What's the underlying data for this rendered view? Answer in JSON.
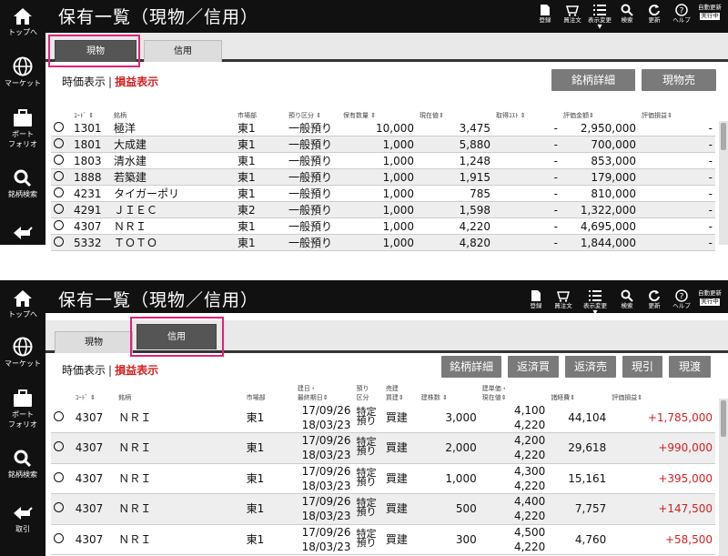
{
  "sidebar": {
    "top": "トップへ",
    "market": "マーケット",
    "portfolio": [
      "ポート",
      "フォリオ"
    ],
    "search": "銘柄検索",
    "trade": "取引"
  },
  "header": {
    "title": "保有一覧（現物／信用）",
    "buttons": [
      "登録",
      "買注文",
      "表示変更",
      "検索",
      "更新",
      "ヘルプ"
    ],
    "live_label": "自動更新",
    "live_state": "実行中"
  },
  "tabs": {
    "cash": "現物",
    "margin": "信用"
  },
  "toolbar": {
    "time": "時価表示",
    "pl": "損益表示"
  },
  "panel1": {
    "buttons": [
      "銘柄詳細",
      "現物売"
    ],
    "headers": [
      "ｺｰﾄﾞ ⇕",
      "銘柄",
      "市場部",
      "預り区分 ⇕",
      "保有数量 ⇕",
      "現在値⇕",
      "取得ｺｽﾄ ⇕",
      "評価金額⇕",
      "評価損益⇕"
    ],
    "rows": [
      [
        "1301",
        "極洋",
        "東1",
        "一般預り",
        "10,000",
        "3,475",
        "-",
        "2,950,000",
        "-"
      ],
      [
        "1801",
        "大成建",
        "東1",
        "一般預り",
        "1,000",
        "5,880",
        "-",
        "700,000",
        "-"
      ],
      [
        "1803",
        "清水建",
        "東1",
        "一般預り",
        "1,000",
        "1,248",
        "-",
        "853,000",
        "-"
      ],
      [
        "1888",
        "若築建",
        "東1",
        "一般預り",
        "1,000",
        "1,915",
        "-",
        "179,000",
        "-"
      ],
      [
        "4231",
        "タイガーポリ",
        "東1",
        "一般預り",
        "1,000",
        "785",
        "-",
        "810,000",
        "-"
      ],
      [
        "4291",
        "ＪＩＥＣ",
        "東2",
        "一般預り",
        "1,000",
        "1,598",
        "-",
        "1,322,000",
        "-"
      ],
      [
        "4307",
        "ＮＲＩ",
        "東1",
        "一般預り",
        "1,000",
        "4,220",
        "-",
        "4,695,000",
        "-"
      ],
      [
        "5332",
        "ＴＯＴＯ",
        "東1",
        "一般預り",
        "1,000",
        "4,820",
        "-",
        "1,844,000",
        "-"
      ]
    ]
  },
  "panel2": {
    "buttons": [
      "銘柄詳細",
      "返済買",
      "返済売",
      "現引",
      "現渡"
    ],
    "headers": [
      "ｺｰﾄﾞ ⇕",
      "銘柄",
      "市場部",
      "建日・\n最終期日⇕",
      "預り\n区分",
      "売建\n買建⇕",
      "建株数 ⇕",
      "建単価・\n現在値⇕",
      "諸経費⇕",
      "評価損益⇕"
    ],
    "rows": [
      [
        "4307",
        "ＮＲＩ",
        "東1",
        "17/09/26",
        "18/03/23",
        "特定預り",
        "買建",
        "3,000",
        "4,100",
        "4,220",
        "44,104",
        "+1,785,000"
      ],
      [
        "4307",
        "ＮＲＩ",
        "東1",
        "17/09/26",
        "18/03/23",
        "特定預り",
        "買建",
        "2,000",
        "4,200",
        "4,220",
        "29,618",
        "+990,000"
      ],
      [
        "4307",
        "ＮＲＩ",
        "東1",
        "17/09/26",
        "18/03/23",
        "特定預り",
        "買建",
        "1,000",
        "4,300",
        "4,220",
        "15,161",
        "+395,000"
      ],
      [
        "4307",
        "ＮＲＩ",
        "東1",
        "17/09/26",
        "18/03/23",
        "特定預り",
        "買建",
        "500",
        "4,400",
        "4,220",
        "7,757",
        "+147,500"
      ],
      [
        "4307",
        "ＮＲＩ",
        "東1",
        "17/09/26",
        "18/03/23",
        "特定預り",
        "買建",
        "300",
        "4,500",
        "4,220",
        "4,760",
        "+58,500"
      ]
    ]
  },
  "colors": {
    "highlight": "#e0227a",
    "profit": "#d42020",
    "dark": "#111111"
  }
}
